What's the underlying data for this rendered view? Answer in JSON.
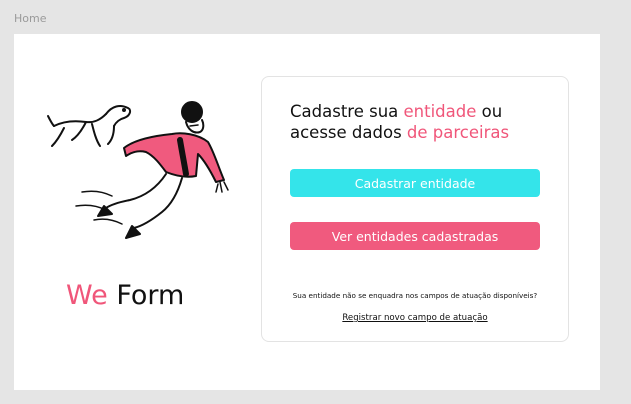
{
  "frame": {
    "label": "Home"
  },
  "brand": {
    "accent_word": "We",
    "rest_word": "Form",
    "accent_color": "#f0567a"
  },
  "headline": {
    "part1": "Cadastre sua ",
    "highlight1": "entidade",
    "part2": " ou",
    "part3": "acesse dados ",
    "highlight2": "de parceiras",
    "highlight_color": "#f0567a"
  },
  "actions": {
    "register_label": "Cadastrar entidade",
    "register_color": "#34e4ea",
    "view_label": "Ver entidades cadastradas",
    "view_color": "#f05a7e"
  },
  "footer": {
    "note": "Sua entidade não se enquadra nos campos de atuação disponíveis?",
    "link_label": "Registrar novo campo de atuação"
  },
  "illustration": {
    "icon": "person-with-dog-illustration"
  }
}
